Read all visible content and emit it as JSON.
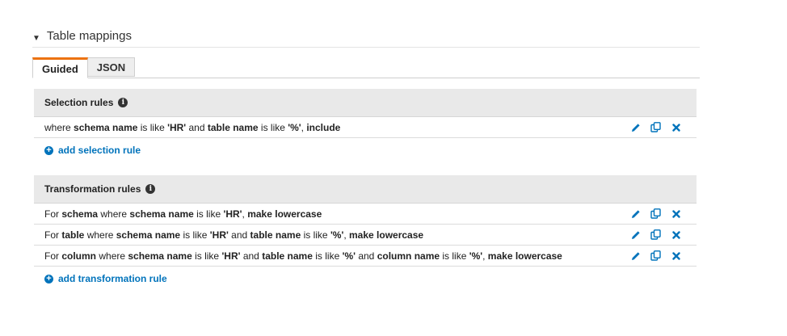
{
  "section": {
    "title": "Table mappings"
  },
  "tabs": [
    {
      "label": "Guided"
    },
    {
      "label": "JSON"
    }
  ],
  "selection": {
    "heading": "Selection rules",
    "rules": [
      [
        {
          "t": "where "
        },
        {
          "t": "schema name",
          "b": true
        },
        {
          "t": " is like "
        },
        {
          "t": "'HR'",
          "b": true
        },
        {
          "t": " and "
        },
        {
          "t": "table name",
          "b": true
        },
        {
          "t": " is like "
        },
        {
          "t": "'%'",
          "b": true
        },
        {
          "t": ", "
        },
        {
          "t": "include",
          "b": true
        }
      ]
    ],
    "add_label": "add selection rule"
  },
  "transformation": {
    "heading": "Transformation rules",
    "rules": [
      [
        {
          "t": "For "
        },
        {
          "t": "schema",
          "b": true
        },
        {
          "t": " where "
        },
        {
          "t": "schema name",
          "b": true
        },
        {
          "t": " is like "
        },
        {
          "t": "'HR'",
          "b": true
        },
        {
          "t": ", "
        },
        {
          "t": "make lowercase",
          "b": true
        }
      ],
      [
        {
          "t": "For "
        },
        {
          "t": "table",
          "b": true
        },
        {
          "t": " where "
        },
        {
          "t": "schema name",
          "b": true
        },
        {
          "t": " is like "
        },
        {
          "t": "'HR'",
          "b": true
        },
        {
          "t": " and "
        },
        {
          "t": "table name",
          "b": true
        },
        {
          "t": " is like "
        },
        {
          "t": "'%'",
          "b": true
        },
        {
          "t": ", "
        },
        {
          "t": "make lowercase",
          "b": true
        }
      ],
      [
        {
          "t": "For "
        },
        {
          "t": "column",
          "b": true
        },
        {
          "t": " where "
        },
        {
          "t": "schema name",
          "b": true
        },
        {
          "t": " is like "
        },
        {
          "t": "'HR'",
          "b": true
        },
        {
          "t": " and "
        },
        {
          "t": "table name",
          "b": true
        },
        {
          "t": " is like "
        },
        {
          "t": "'%'",
          "b": true
        },
        {
          "t": " and "
        },
        {
          "t": "column name",
          "b": true
        },
        {
          "t": " is like "
        },
        {
          "t": "'%'",
          "b": true
        },
        {
          "t": ", "
        },
        {
          "t": "make lowercase",
          "b": true
        }
      ]
    ],
    "add_label": "add transformation rule"
  },
  "icons": {
    "edit": "pencil-icon",
    "copy": "copy-icon",
    "delete": "close-icon",
    "info": "info-icon",
    "add": "plus-circle-icon"
  },
  "colors": {
    "accent_tab": "#ec7211",
    "link": "#0073bb"
  }
}
